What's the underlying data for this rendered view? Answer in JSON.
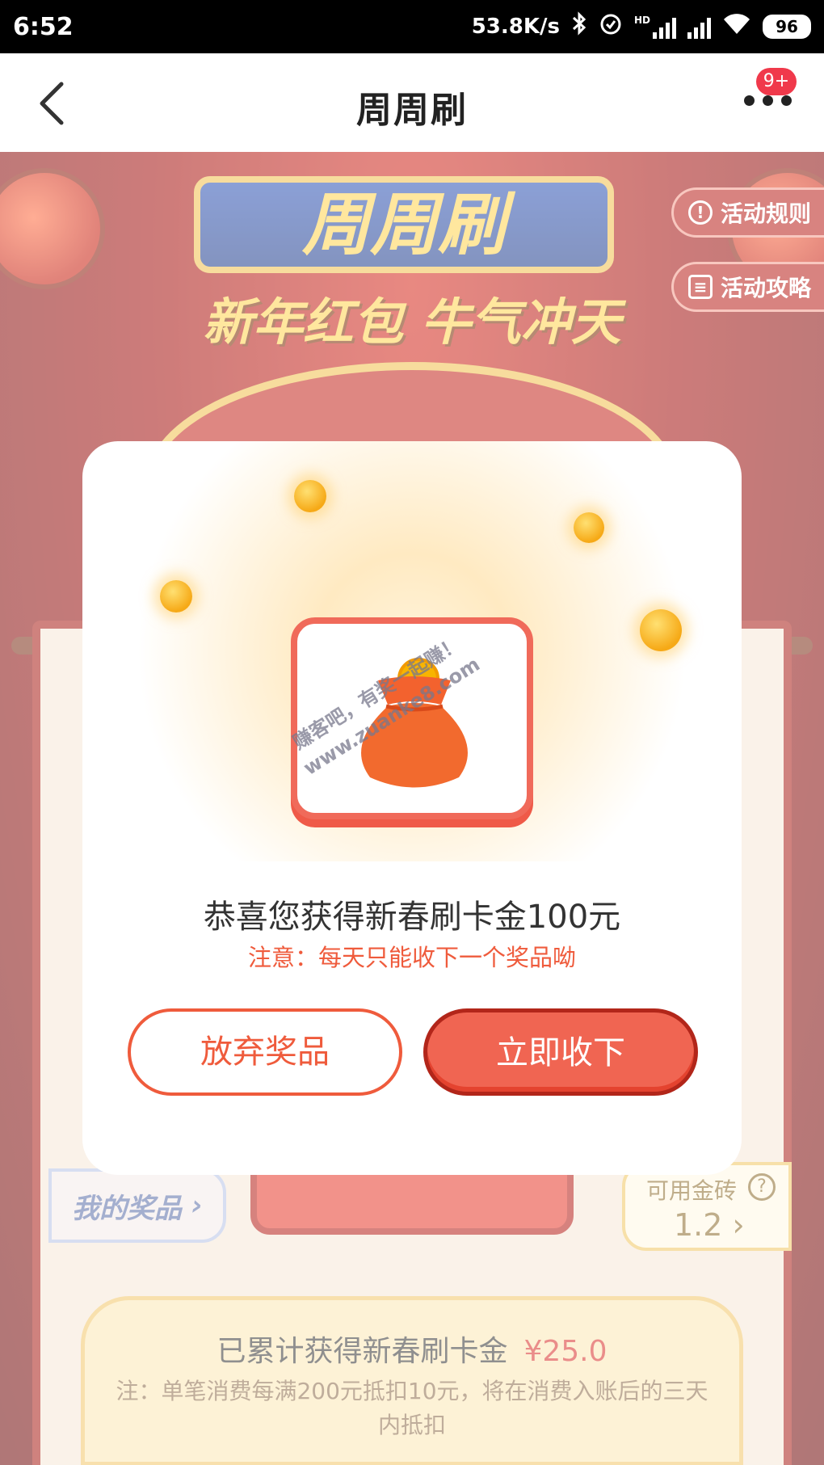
{
  "status_bar": {
    "time": "6:52",
    "network_speed": "53.8K/s",
    "network_type": "HD",
    "battery": "96",
    "icons": [
      "bluetooth-icon",
      "alarm-icon",
      "signal-icon",
      "signal-icon",
      "wifi-icon",
      "battery-icon"
    ]
  },
  "nav": {
    "title": "周周刷",
    "badge": "9+",
    "icons": [
      "back-icon",
      "more-icon"
    ]
  },
  "background": {
    "poster_title": "周周刷",
    "poster_subtitle": "新年红包 牛气冲天",
    "tabs": {
      "rules": "活动规则",
      "guide": "活动攻略"
    },
    "my_prizes": "我的奖品",
    "gold": {
      "label": "可用金砖",
      "value": "1.2"
    },
    "total": {
      "label": "已累计获得新春刷卡金",
      "amount": "¥25.0",
      "note": "注：单笔消费每满200元抵扣10元，将在消费入账后的三天内抵扣"
    }
  },
  "modal": {
    "watermark_line1": "赚客吧，有奖一起赚！",
    "watermark_line2": "www.zuanke8.com",
    "title": "恭喜您获得新春刷卡金100元",
    "note": "注意：每天只能收下一个奖品呦",
    "give_up_label": "放弃奖品",
    "accept_label": "立即收下",
    "colors": {
      "accent": "#ef5b3c",
      "button_fill": "#f06552"
    }
  }
}
